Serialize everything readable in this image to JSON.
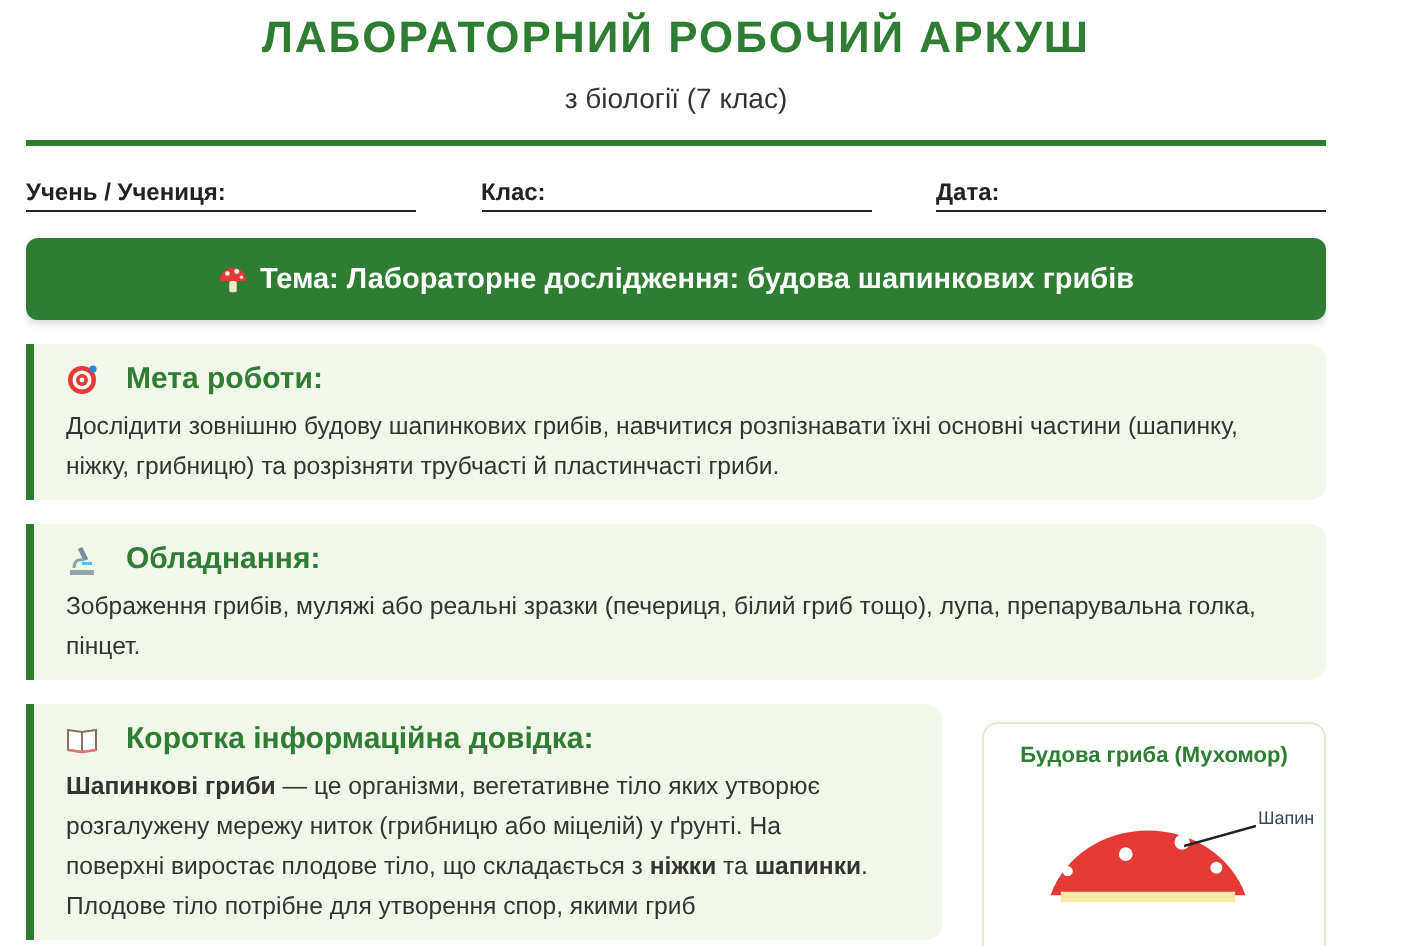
{
  "header": {
    "title": "ЛАБОРАТОРНИЙ РОБОЧИЙ АРКУШ",
    "subtitle": "з біології (7 клас)"
  },
  "fields": [
    {
      "label": "Учень / Учениця:"
    },
    {
      "label": "Клас:"
    },
    {
      "label": "Дата:"
    }
  ],
  "topic": "Тема: Лабораторне дослідження: будова шапинкових грибів",
  "sections": [
    {
      "kind": "goal",
      "heading": "Мета роботи:",
      "text": "Дослідити зовнішню будову шапинкових грибів, навчитися розпізнавати їхні основні частини (шапинку, ніжку, грибницю) та розрізняти трубчасті й пластинчасті гриби."
    },
    {
      "kind": "equipment",
      "heading": "Обладнання:",
      "text": "Зображення грибів, муляжі або реальні зразки (печериця, білий гриб тощо), лупа, препарувальна голка, пінцет."
    }
  ],
  "info": {
    "kind": "book",
    "heading": "Коротка інформаційна довідка:",
    "text": "**Шапинкові гриби** — це організми, вегетативне тіло яких утворює розгалужену мережу ниток (грибницю або міцелій) у ґрунті. На поверхні виростає плодове тіло, що складається з **ніжки** та **шапинки**. Плодове тіло потрібне для утворення спор, якими гриб"
  },
  "diagram": {
    "title": "Будова гриба (Мухомор)",
    "labels": [
      "Шапин"
    ]
  }
}
